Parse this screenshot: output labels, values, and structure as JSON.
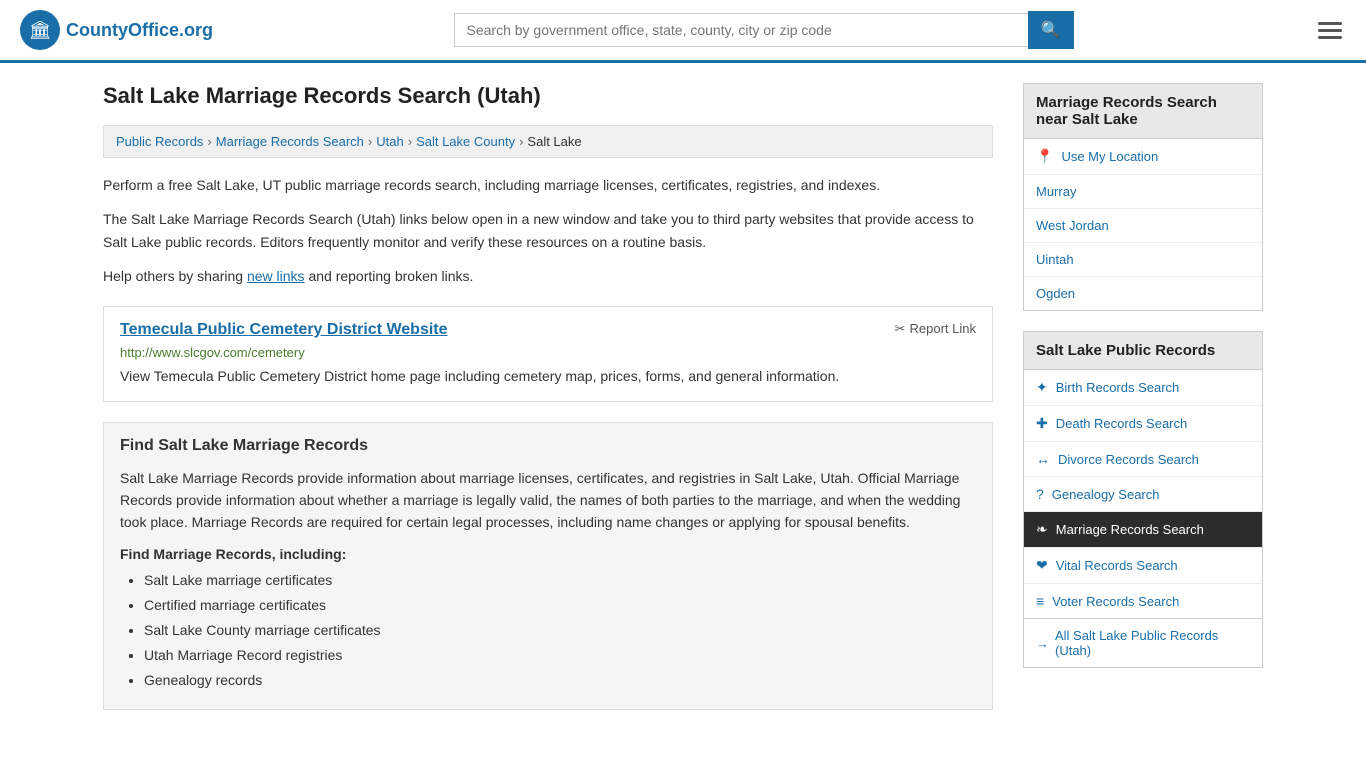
{
  "header": {
    "logo_org": "CountyOffice",
    "logo_tld": ".org",
    "search_placeholder": "Search by government office, state, county, city or zip code"
  },
  "page": {
    "title": "Salt Lake Marriage Records Search (Utah)"
  },
  "breadcrumb": {
    "items": [
      {
        "label": "Public Records",
        "href": "#"
      },
      {
        "label": "Marriage Records Search",
        "href": "#"
      },
      {
        "label": "Utah",
        "href": "#"
      },
      {
        "label": "Salt Lake County",
        "href": "#"
      },
      {
        "label": "Salt Lake",
        "href": "#",
        "current": true
      }
    ]
  },
  "description": {
    "paragraph1": "Perform a free Salt Lake, UT public marriage records search, including marriage licenses, certificates, registries, and indexes.",
    "paragraph2": "The Salt Lake Marriage Records Search (Utah) links below open in a new window and take you to third party websites that provide access to Salt Lake public records. Editors frequently monitor and verify these resources on a routine basis.",
    "paragraph3_prefix": "Help others by sharing ",
    "new_links_text": "new links",
    "paragraph3_suffix": " and reporting broken links."
  },
  "link_card": {
    "title": "Temecula Public Cemetery District Website",
    "url": "http://www.slcgov.com/cemetery",
    "description": "View Temecula Public Cemetery District home page including cemetery map, prices, forms, and general information.",
    "report_label": "Report Link"
  },
  "info_section": {
    "heading": "Find Salt Lake Marriage Records",
    "paragraph1": "Salt Lake Marriage Records provide information about marriage licenses, certificates, and registries in Salt Lake, Utah. Official Marriage Records provide information about whether a marriage is legally valid, the names of both parties to the marriage, and when the wedding took place. Marriage Records are required for certain legal processes, including name changes or applying for spousal benefits.",
    "subheading": "Find Marriage Records, including:",
    "list_items": [
      "Salt Lake marriage certificates",
      "Certified marriage certificates",
      "Salt Lake County marriage certificates",
      "Utah Marriage Record registries",
      "Genealogy records"
    ]
  },
  "sidebar": {
    "nearby_section_title": "Marriage Records Search near Salt Lake",
    "use_my_location": "Use My Location",
    "nearby_locations": [
      {
        "label": "Murray"
      },
      {
        "label": "West Jordan"
      },
      {
        "label": "Uintah"
      },
      {
        "label": "Ogden"
      }
    ],
    "public_records_title": "Salt Lake Public Records",
    "records_links": [
      {
        "label": "Birth Records Search",
        "icon": "✦",
        "active": false
      },
      {
        "label": "Death Records Search",
        "icon": "✚",
        "active": false
      },
      {
        "label": "Divorce Records Search",
        "icon": "↔",
        "active": false
      },
      {
        "label": "Genealogy Search",
        "icon": "?",
        "active": false
      },
      {
        "label": "Marriage Records Search",
        "icon": "❧",
        "active": true
      },
      {
        "label": "Vital Records Search",
        "icon": "❤",
        "active": false
      },
      {
        "label": "Voter Records Search",
        "icon": "≡",
        "active": false
      }
    ],
    "all_records_label": "All Salt Lake Public Records (Utah)",
    "all_records_icon": "→"
  }
}
